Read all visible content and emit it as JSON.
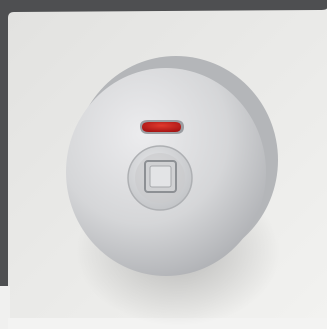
{
  "photo": {
    "subject": "bathroom-privacy-lock-indicator",
    "indicator_state": "occupied",
    "colors": {
      "backdrop": "#4a4c4e",
      "door_panel": "#e8e8e6",
      "lock_body": "#d4d5d7",
      "lock_face": "#dcdddf",
      "indicator_red": "#c21a1a",
      "turn_knob": "#cfd0d2"
    }
  }
}
